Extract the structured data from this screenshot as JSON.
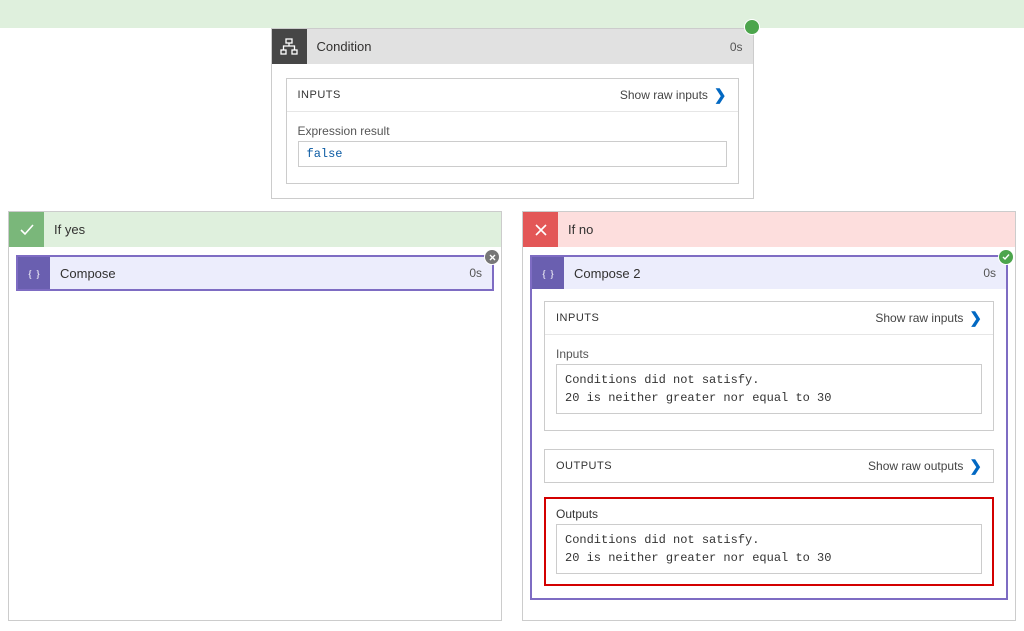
{
  "condition": {
    "title": "Condition",
    "duration": "0s",
    "inputs_header": "INPUTS",
    "show_raw_inputs": "Show raw inputs",
    "expression_label": "Expression result",
    "expression_value": "false"
  },
  "branch_yes": {
    "title": "If yes",
    "compose": {
      "title": "Compose",
      "duration": "0s"
    }
  },
  "branch_no": {
    "title": "If no",
    "compose": {
      "title": "Compose 2",
      "duration": "0s",
      "inputs_header": "INPUTS",
      "show_raw_inputs": "Show raw inputs",
      "inputs_label": "Inputs",
      "inputs_value": "Conditions did not satisfy.\n20 is neither greater nor equal to 30",
      "outputs_header": "OUTPUTS",
      "show_raw_outputs": "Show raw outputs",
      "outputs_label": "Outputs",
      "outputs_value": "Conditions did not satisfy.\n20 is neither greater nor equal to 30"
    }
  }
}
